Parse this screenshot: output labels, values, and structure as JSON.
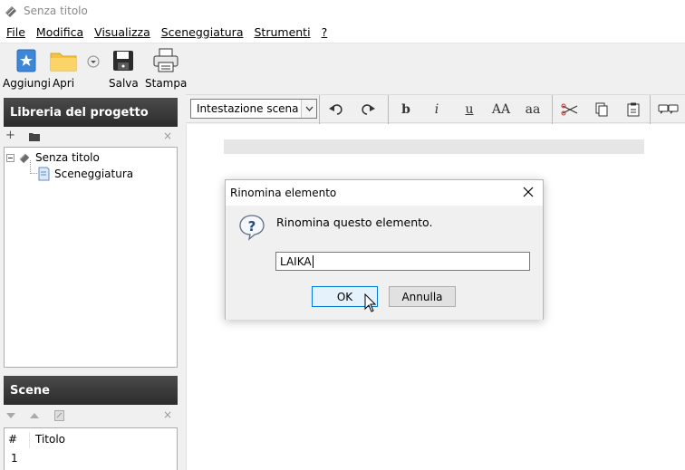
{
  "window": {
    "title": "Senza titolo"
  },
  "menu": [
    "File",
    "Modifica",
    "Visualizza",
    "Sceneggiatura",
    "Strumenti",
    "?"
  ],
  "toolbar": {
    "add_label": "Aggiungi",
    "open_label": "Apri",
    "save_label": "Salva",
    "print_label": "Stampa"
  },
  "project_library": {
    "title": "Libreria del progetto",
    "tree": {
      "root_label": "Senza titolo",
      "child_label": "Sceneggiatura"
    }
  },
  "scenes": {
    "title": "Scene",
    "columns": [
      "#",
      "Titolo"
    ],
    "rows": [
      {
        "num": "1",
        "title": ""
      }
    ]
  },
  "editor_toolbar": {
    "style_value": "Intestazione scena",
    "bold": "b",
    "italic": "i",
    "underline": "u",
    "uppercase": "AA",
    "lowercase": "aa"
  },
  "dialog": {
    "title": "Rinomina elemento",
    "message": "Rinomina questo elemento.",
    "input_value": "LAIKA",
    "ok_label": "OK",
    "cancel_label": "Annulla"
  },
  "colors": {
    "panel_header": "#2c2c2c",
    "ok_border": "#0078d7",
    "folder": "#f5c342",
    "add_icon": "#3e86d6"
  }
}
